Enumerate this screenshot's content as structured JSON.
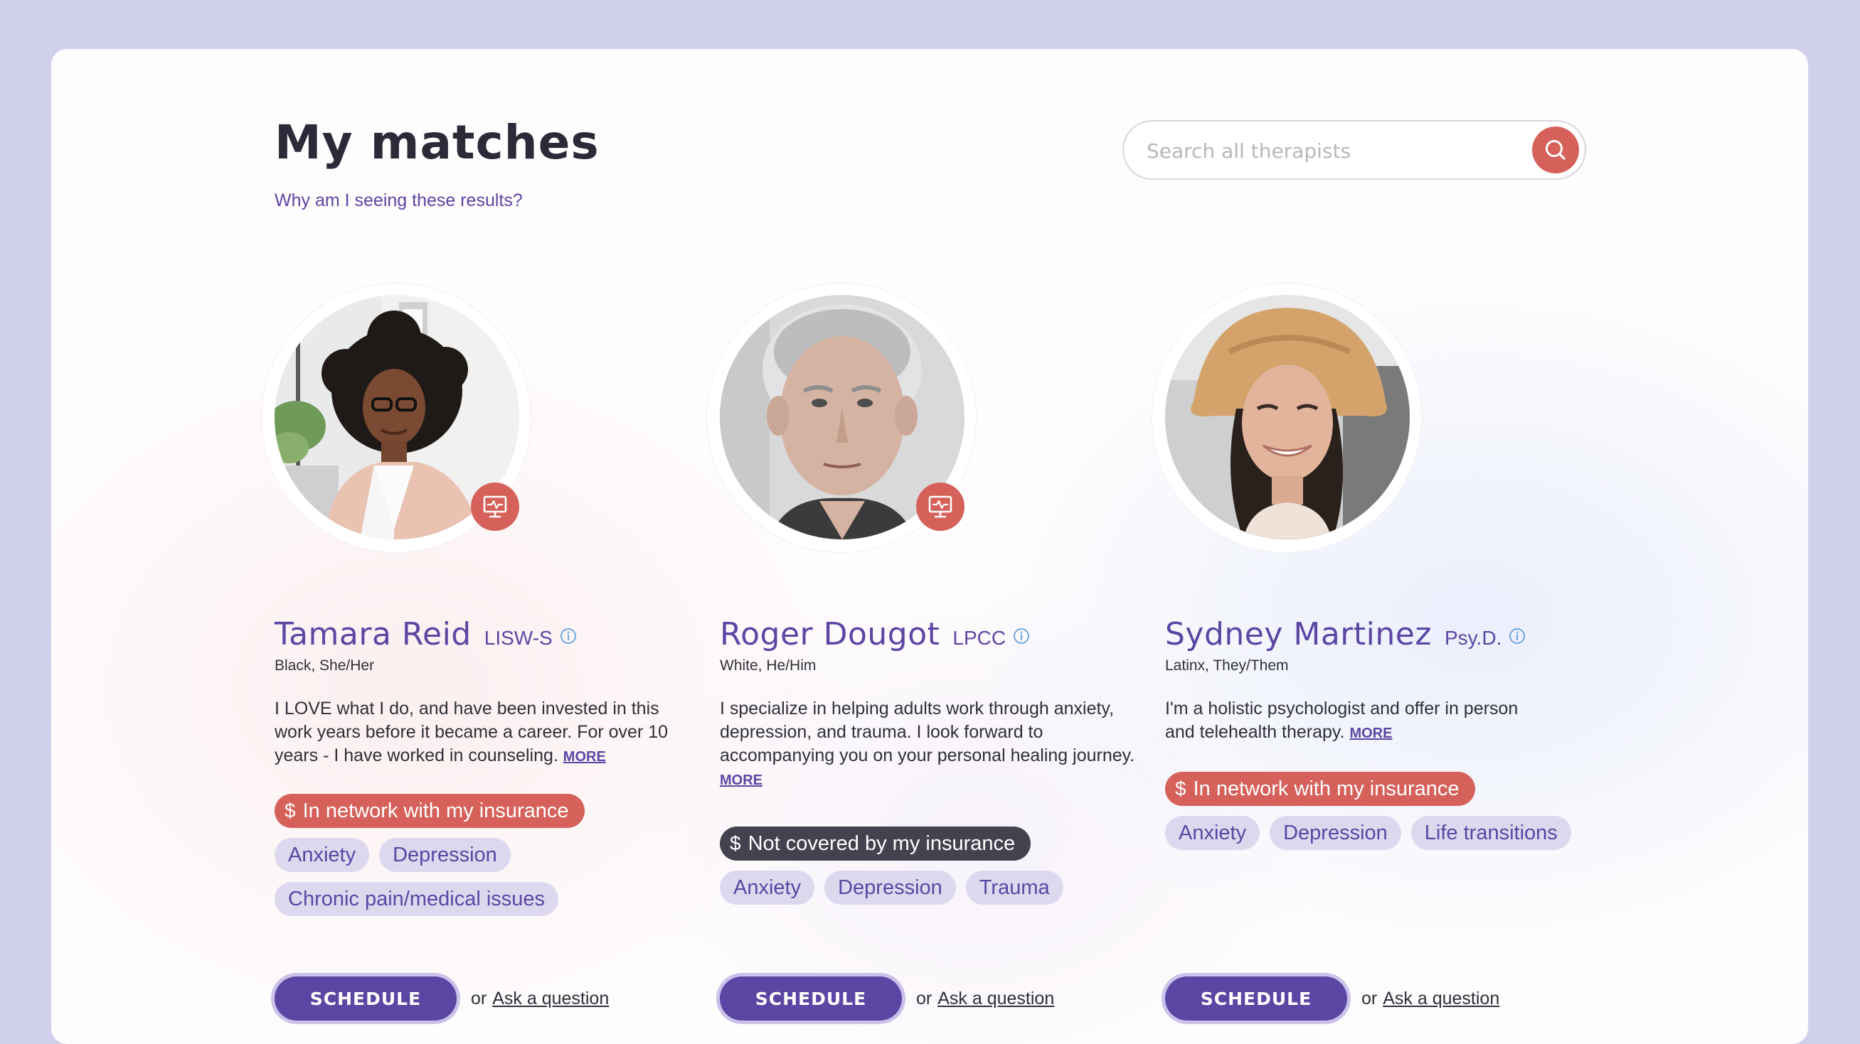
{
  "page": {
    "title": "My matches",
    "why_link": "Why am I seeing these results?"
  },
  "search": {
    "placeholder": "Search all therapists",
    "icon": "search-icon"
  },
  "colors": {
    "brand_purple": "#5b46a3",
    "coral": "#d6605a",
    "dark_badge": "#43434f",
    "tag_bg": "#dcd9ef",
    "page_bg": "#d1d0ec"
  },
  "therapists": [
    {
      "name": "Tamara Reid",
      "credential": "LISW-S",
      "identity": "Black, She/Her",
      "bio": "I LOVE what I do, and have been invested in this work years before it became a career. For over 10 years - I have worked in counseling.",
      "more": "MORE",
      "telehealth": true,
      "insurance": "In network with my insurance",
      "insurance_status": "in-network",
      "specialties": [
        "Anxiety",
        "Depression",
        "Chronic pain/medical issues"
      ],
      "schedule_label": "SCHEDULE",
      "or_text": "or",
      "ask_label": "Ask a question"
    },
    {
      "name": "Roger Dougot",
      "credential": "LPCC",
      "identity": "White, He/Him",
      "bio": "I specialize in helping adults work through anxiety, depression, and trauma. I look forward to accompanying you on your personal healing journey.",
      "more": "MORE",
      "telehealth": true,
      "insurance": "Not covered by my insurance",
      "insurance_status": "not-covered",
      "specialties": [
        "Anxiety",
        "Depression",
        "Trauma"
      ],
      "schedule_label": "SCHEDULE",
      "or_text": "or",
      "ask_label": "Ask a question"
    },
    {
      "name": "Sydney Martinez",
      "credential": "Psy.D.",
      "identity": "Latinx, They/Them",
      "bio": "I'm a holistic psychologist and offer in person and telehealth therapy.",
      "more": "MORE",
      "telehealth": false,
      "insurance": "In network with my insurance",
      "insurance_status": "in-network",
      "specialties": [
        "Anxiety",
        "Depression",
        "Life transitions"
      ],
      "schedule_label": "SCHEDULE",
      "or_text": "or",
      "ask_label": "Ask a question"
    }
  ]
}
